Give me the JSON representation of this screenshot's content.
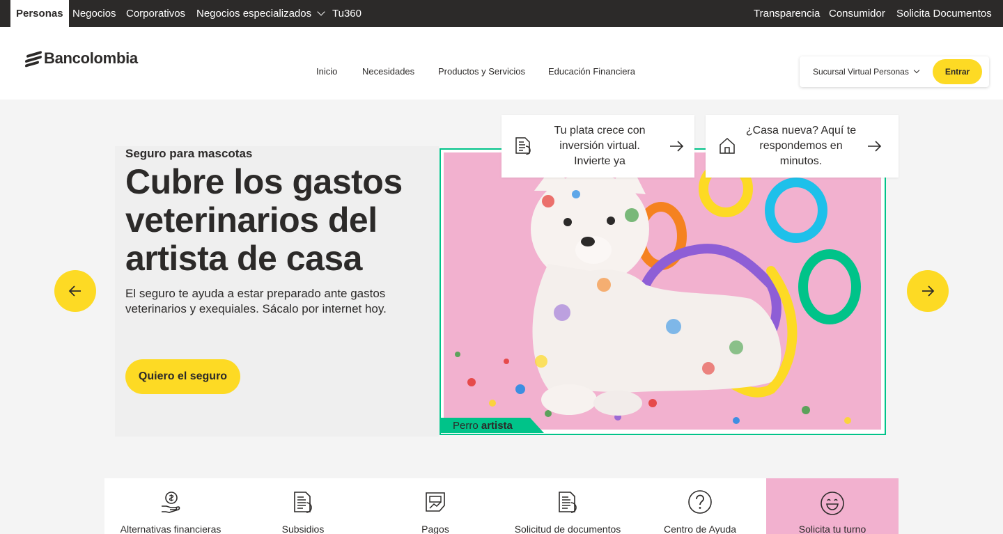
{
  "topbar": {
    "left": [
      "Personas",
      "Negocios",
      "Corporativos",
      "Negocios especializados",
      "Tu360"
    ],
    "right": [
      "Transparencia",
      "Consumidor",
      "Solicita Documentos"
    ]
  },
  "header": {
    "logo_text": "Bancolombia",
    "nav": [
      "Inicio",
      "Necesidades",
      "Productos y Servicios",
      "Educación Financiera"
    ],
    "sucursal_label": "Sucursal Virtual Personas",
    "entrar_label": "Entrar"
  },
  "hero": {
    "eyebrow": "Seguro para mascotas",
    "title": "Cubre los gastos veterinarios del artista de casa",
    "description": "El seguro te ayuda a estar preparado ante gastos veterinarios y exequiales. Sácalo por internet hoy.",
    "cta_label": "Quiero el seguro",
    "image_label_light": "Perro ",
    "image_label_bold": "artista"
  },
  "promos": [
    {
      "text_l1": "Tu plata crece con",
      "text_l2": "inversión virtual.",
      "text_l3": "Invierte ya",
      "icon": "document-icon"
    },
    {
      "text_l1": "¿Casa nueva? Aquí te",
      "text_l2": "respondemos en",
      "text_l3": "minutos.",
      "icon": "house-icon"
    }
  ],
  "quick_access": [
    {
      "label": "Alternativas financieras",
      "icon": "hand-coin-icon"
    },
    {
      "label": "Subsidios",
      "icon": "document-icon"
    },
    {
      "label": "Pagos",
      "icon": "payment-icon"
    },
    {
      "label": "Solicitud de documentos",
      "icon": "document-icon"
    },
    {
      "label": "Centro de Ayuda",
      "icon": "help-icon"
    },
    {
      "label": "Solicita tu turno",
      "icon": "smile-icon"
    }
  ],
  "colors": {
    "topbar": "#2c2a29",
    "accent_yellow": "#fdda24",
    "frame_green": "#00c389",
    "photo_pink": "#f2b1cf"
  }
}
